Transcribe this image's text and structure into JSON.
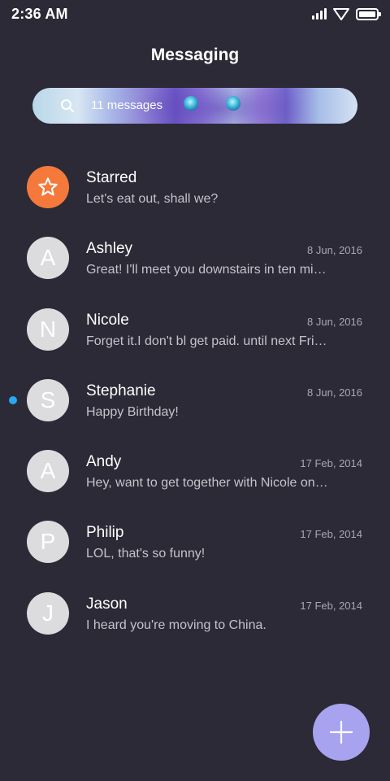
{
  "status_bar": {
    "time": "2:36 AM",
    "icons": [
      "signal-icon",
      "wifi-icon",
      "battery-icon"
    ]
  },
  "header": {
    "title": "Messaging"
  },
  "search": {
    "text": "11 messages",
    "icon": "search-icon"
  },
  "conversations": [
    {
      "name": "Starred",
      "preview": "Let's eat out, shall we?",
      "date": "",
      "avatar": "star-icon",
      "unread": false
    },
    {
      "name": "Ashley",
      "preview": "Great! I'll meet you downstairs in ten minutes.",
      "date": "8 Jun, 2016",
      "avatar": "A",
      "unread": false
    },
    {
      "name": "Nicole",
      "preview": "Forget it.I don't bl get paid. until next Friday.",
      "date": "8 Jun, 2016",
      "avatar": "N",
      "unread": false
    },
    {
      "name": "Stephanie",
      "preview": "Happy Birthday!",
      "date": "8 Jun, 2016",
      "avatar": "S",
      "unread": true
    },
    {
      "name": "Andy",
      "preview": "Hey, want to get together with Nicole on Saturday?",
      "date": "17 Feb, 2014",
      "avatar": "A",
      "unread": false
    },
    {
      "name": "Philip",
      "preview": "LOL, that's so funny!",
      "date": "17 Feb, 2014",
      "avatar": "P",
      "unread": false
    },
    {
      "name": "Jason",
      "preview": "I heard you're moving to China.",
      "date": "17 Feb, 2014",
      "avatar": "J",
      "unread": false
    }
  ],
  "fab": {
    "icon": "plus-icon"
  },
  "colors": {
    "background": "#2b2a36",
    "starred_avatar": "#f5793b",
    "avatar": "#dcdcdf",
    "unread_dot": "#27a8f2",
    "fab": "#a8a3ef"
  }
}
